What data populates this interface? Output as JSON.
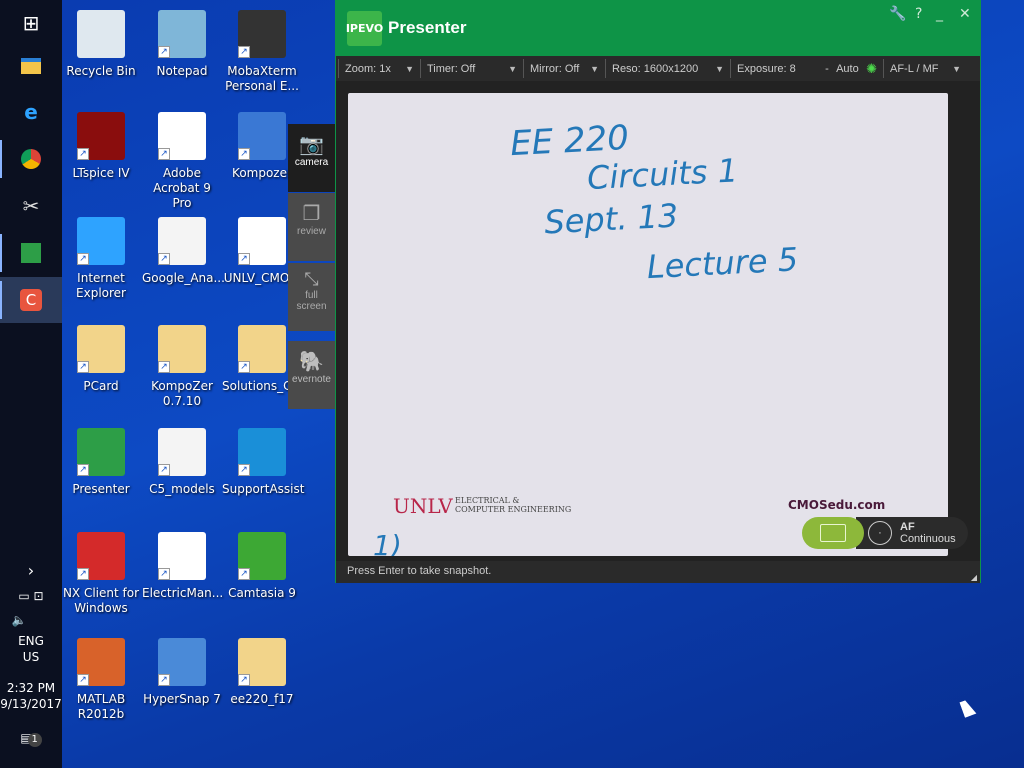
{
  "taskbar": {
    "lang1": "ENG",
    "lang2": "US",
    "time": "2:32 PM",
    "date": "9/13/2017",
    "notif_count": "1",
    "chevron": "›"
  },
  "desktop_icons": [
    {
      "label": "Recycle Bin",
      "icon": "recycle-bin-icon"
    },
    {
      "label": "Notepad",
      "icon": "notepad-icon"
    },
    {
      "label": "MobaXterm Personal E...",
      "icon": "mobaxterm-icon"
    },
    {
      "label": "LTspice IV",
      "icon": "ltspice-icon"
    },
    {
      "label": "Adobe Acrobat 9 Pro",
      "icon": "acrobat-icon"
    },
    {
      "label": "Kompozer",
      "icon": "kompozer-icon"
    },
    {
      "label": "Internet Explorer",
      "icon": "ie-icon"
    },
    {
      "label": "Google_Ana...",
      "icon": "document-icon"
    },
    {
      "label": "UNLV_CMO...",
      "icon": "image-icon"
    },
    {
      "label": "PCard",
      "icon": "folder-icon"
    },
    {
      "label": "KompoZer 0.7.10",
      "icon": "folder-icon"
    },
    {
      "label": "Solutions_C...",
      "icon": "folder-icon"
    },
    {
      "label": "Presenter",
      "icon": "presenter-icon"
    },
    {
      "label": "C5_models",
      "icon": "document-icon"
    },
    {
      "label": "SupportAssist",
      "icon": "supportassist-icon"
    },
    {
      "label": "NX Client for Windows",
      "icon": "nx-client-icon"
    },
    {
      "label": "ElectricMan...",
      "icon": "pdf-icon"
    },
    {
      "label": "Camtasia 9",
      "icon": "camtasia-icon"
    },
    {
      "label": "MATLAB R2012b",
      "icon": "matlab-icon"
    },
    {
      "label": "HyperSnap 7",
      "icon": "hypersnap-icon"
    },
    {
      "label": "ee220_f17",
      "icon": "folder-icon"
    }
  ],
  "presenter": {
    "logo": "IPEVO",
    "title": "Presenter",
    "controls": {
      "settings": "🔧",
      "help": "?",
      "minimize": "_",
      "close": "✕"
    },
    "toolbar": [
      {
        "label": "Zoom: 1x"
      },
      {
        "label": "Timer: Off"
      },
      {
        "label": "Mirror: Off"
      },
      {
        "label": "Reso: 1600x1200"
      }
    ],
    "exposure": {
      "label": "Exposure: 8",
      "minus": "-",
      "auto": "Auto"
    },
    "focus": "AF-L / MF",
    "side_tabs": [
      {
        "label": "camera"
      },
      {
        "label": "review"
      },
      {
        "label": "full screen"
      },
      {
        "label": "evernote"
      }
    ],
    "paper": {
      "lines": [
        "EE  220",
        "Circuits 1",
        "Sept. 13",
        "Lecture 5"
      ],
      "logo": "UNLV",
      "dept1": "ELECTRICAL &",
      "dept2": "COMPUTER ENGINEERING",
      "site": "CMOSedu.com",
      "page": "1)"
    },
    "af": {
      "title": "AF",
      "mode": "Continuous"
    },
    "status": "Press Enter to take snapshot."
  }
}
